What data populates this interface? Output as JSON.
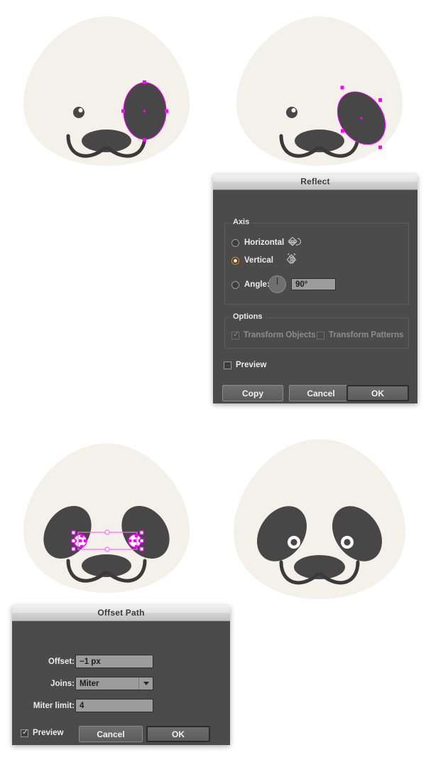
{
  "canvas": {
    "background": "#ffffff",
    "face_fill": "#f4f1ea",
    "ink": "#474747",
    "eye_white": "#ffffff",
    "selection_color": "#ff00ff",
    "selection_box": "#ff66ff"
  },
  "panels": [
    {
      "id": "panel-1",
      "name": "panda-single-eyepatch-selected",
      "caption": "Panda head with one upright eye patch selected"
    },
    {
      "id": "panel-2",
      "name": "panda-eyepatch-rotated",
      "caption": "Panda head with eye patch rotated"
    },
    {
      "id": "panel-3",
      "name": "panda-both-eyes-selected",
      "caption": "Panda head with both pupils selected"
    },
    {
      "id": "panel-4",
      "name": "panda-finished",
      "caption": "Finished panda head"
    }
  ],
  "reflect_dialog": {
    "title": "Reflect",
    "axis_group": {
      "legend": "Axis",
      "options": [
        {
          "label": "Horizontal",
          "selected": false,
          "icon": "reflect-horizontal-icon"
        },
        {
          "label": "Vertical",
          "selected": true,
          "icon": "reflect-vertical-icon"
        },
        {
          "label": "Angle:",
          "selected": false,
          "icon": "angle-dial-icon"
        }
      ],
      "angle_value": "90°"
    },
    "options_group": {
      "legend": "Options",
      "checkboxes": [
        {
          "label": "Transform Objects",
          "checked": true,
          "disabled": true
        },
        {
          "label": "Transform Patterns",
          "checked": false,
          "disabled": true
        }
      ]
    },
    "preview": {
      "label": "Preview",
      "checked": false
    },
    "buttons": [
      {
        "label": "Copy",
        "default": false
      },
      {
        "label": "Cancel",
        "default": false
      },
      {
        "label": "OK",
        "default": true
      }
    ]
  },
  "offset_path_dialog": {
    "title": "Offset Path",
    "fields": [
      {
        "label": "Offset:",
        "value": "−1 px",
        "type": "text"
      },
      {
        "label": "Joins:",
        "value": "Miter",
        "type": "select"
      },
      {
        "label": "Miter limit:",
        "value": "4",
        "type": "text"
      }
    ],
    "preview": {
      "label": "Preview",
      "checked": true
    },
    "buttons": [
      {
        "label": "Cancel",
        "default": false
      },
      {
        "label": "OK",
        "default": true
      }
    ]
  }
}
